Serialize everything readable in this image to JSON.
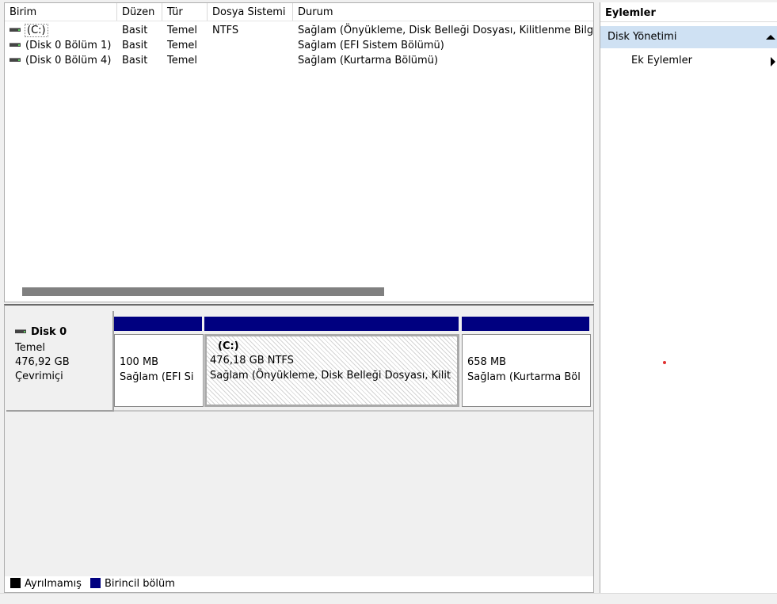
{
  "volume_list": {
    "columns": [
      "Birim",
      "Düzen",
      "Tür",
      "Dosya Sistemi",
      "Durum"
    ],
    "rows": [
      {
        "birim": "(C:)",
        "duzen": "Basit",
        "tur": "Temel",
        "dosya": "NTFS",
        "durum": "Sağlam (Önyükleme, Disk Belleği Dosyası, Kilitlenme Bilgi"
      },
      {
        "birim": "(Disk 0 Bölüm 1)",
        "duzen": "Basit",
        "tur": "Temel",
        "dosya": "",
        "durum": "Sağlam (EFI Sistem Bölümü)"
      },
      {
        "birim": "(Disk 0 Bölüm 4)",
        "duzen": "Basit",
        "tur": "Temel",
        "dosya": "",
        "durum": "Sağlam (Kurtarma Bölümü)"
      }
    ]
  },
  "disk": {
    "name": "Disk 0",
    "type": "Temel",
    "size": "476,92 GB",
    "status": "Çevrimiçi",
    "partitions": [
      {
        "title": "",
        "size": "100 MB",
        "status": "Sağlam (EFI Si"
      },
      {
        "title": "(C:)",
        "size": "476,18 GB NTFS",
        "status": "Sağlam (Önyükleme, Disk Belleği Dosyası, Kilit"
      },
      {
        "title": "",
        "size": "658 MB",
        "status": "Sağlam (Kurtarma Böl"
      }
    ]
  },
  "legend": {
    "unallocated": "Ayrılmamış",
    "primary": "Birincil bölüm",
    "unallocated_color": "#000000",
    "primary_color": "#000080"
  },
  "actions": {
    "title": "Eylemler",
    "section": "Disk Yönetimi",
    "more": "Ek Eylemler"
  }
}
